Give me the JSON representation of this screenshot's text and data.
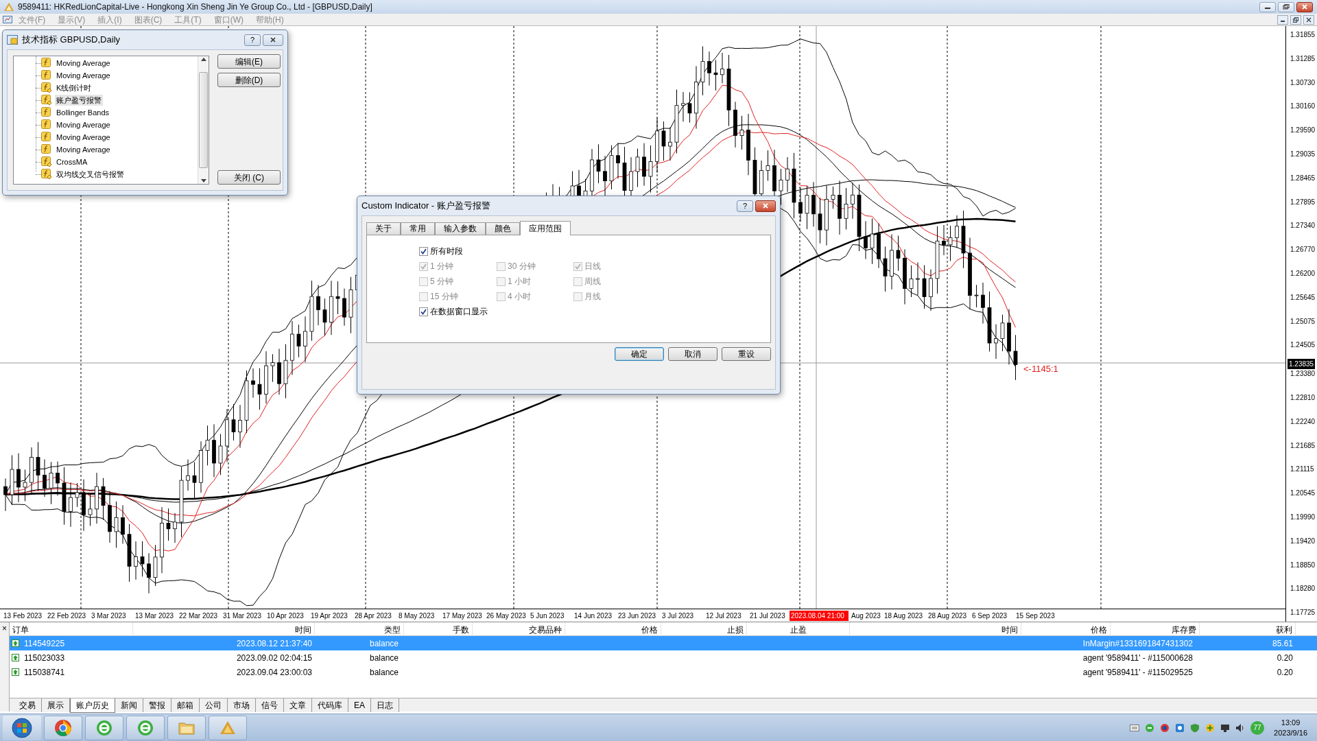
{
  "window": {
    "title": "9589411: HKRedLionCapital-Live - Hongkong Xin Sheng Jin Ye Group Co., Ltd - [GBPUSD,Daily]"
  },
  "menu": [
    "文件(F)",
    "显示(V)",
    "插入(I)",
    "图表(C)",
    "工具(T)",
    "窗口(W)",
    "帮助(H)"
  ],
  "chart": {
    "price_labels": [
      "1.31855",
      "1.31285",
      "1.30730",
      "1.30160",
      "1.29590",
      "1.29035",
      "1.28465",
      "1.27895",
      "1.27340",
      "1.26770",
      "1.26200",
      "1.25645",
      "1.25075",
      "1.24505",
      "1.23380",
      "1.22810",
      "1.22240",
      "1.21685",
      "1.21115",
      "1.20545",
      "1.19990",
      "1.19420",
      "1.18850",
      "1.18280",
      "1.17725"
    ],
    "current_price": "1.23835",
    "annotation": "<-1145:1",
    "date_labels": [
      {
        "text": "13 Feb 2023",
        "kind": "date"
      },
      {
        "text": "22 Feb 2023",
        "kind": "date"
      },
      {
        "text": "3 Mar 2023",
        "kind": "date"
      },
      {
        "text": "13 Mar 2023",
        "kind": "date"
      },
      {
        "text": "22 Mar 2023",
        "kind": "date"
      },
      {
        "text": "31 Mar 2023",
        "kind": "date"
      },
      {
        "text": "10 Apr 2023",
        "kind": "date"
      },
      {
        "text": "19 Apr 2023",
        "kind": "date"
      },
      {
        "text": "28 Apr 2023",
        "kind": "date"
      },
      {
        "text": "8 May 2023",
        "kind": "date"
      },
      {
        "text": "17 May 2023",
        "kind": "date"
      },
      {
        "text": "26 May 2023",
        "kind": "date"
      },
      {
        "text": "5 Jun 2023",
        "kind": "date"
      },
      {
        "text": "14 Jun 2023",
        "kind": "date"
      },
      {
        "text": "23 Jun 2023",
        "kind": "date"
      },
      {
        "text": "3 Jul 2023",
        "kind": "date"
      },
      {
        "text": "12 Jul 2023",
        "kind": "date"
      },
      {
        "text": "21 Jul 2023",
        "kind": "date"
      },
      {
        "text": "2023.08.04 21:00",
        "kind": "cursor"
      },
      {
        "text": "Aug 2023",
        "kind": "partial"
      },
      {
        "text": "18 Aug 2023",
        "kind": "date"
      },
      {
        "text": "28 Aug 2023",
        "kind": "date"
      },
      {
        "text": "6 Sep 2023",
        "kind": "date"
      },
      {
        "text": "15 Sep 2023",
        "kind": "date"
      }
    ]
  },
  "indicators_dialog": {
    "title": "技术指标 GBPUSD,Daily",
    "help": "?",
    "items": [
      {
        "name": "Moving Average",
        "kind": "builtin",
        "selected": false
      },
      {
        "name": "Moving Average",
        "kind": "builtin",
        "selected": false
      },
      {
        "name": "K线倒计时",
        "kind": "custom",
        "selected": false
      },
      {
        "name": "账户盈亏报警",
        "kind": "custom",
        "selected": true
      },
      {
        "name": "Bollinger Bands",
        "kind": "builtin",
        "selected": false
      },
      {
        "name": "Moving Average",
        "kind": "builtin",
        "selected": false
      },
      {
        "name": "Moving Average",
        "kind": "builtin",
        "selected": false
      },
      {
        "name": "Moving Average",
        "kind": "builtin",
        "selected": false
      },
      {
        "name": "CrossMA",
        "kind": "custom",
        "selected": false
      },
      {
        "name": "双均线交叉信号报警",
        "kind": "custom",
        "selected": false
      }
    ],
    "buttons": [
      "编辑(E)",
      "删除(D)",
      "关闭 (C)"
    ]
  },
  "custom_indicator_dialog": {
    "title": "Custom Indicator - 账户盈亏报警",
    "help": "?",
    "tabs": [
      {
        "label": "关于",
        "selected": false
      },
      {
        "label": "常用",
        "selected": false
      },
      {
        "label": "输入参数",
        "selected": false
      },
      {
        "label": "颜色",
        "selected": false
      },
      {
        "label": "应用范围",
        "selected": true
      }
    ],
    "all_periods": {
      "label": "所有时段",
      "checked": true,
      "disabled": false
    },
    "periods": [
      {
        "label": "1 分钟",
        "checked": true,
        "disabled": true
      },
      {
        "label": "30 分钟",
        "checked": false,
        "disabled": true
      },
      {
        "label": "日线",
        "checked": true,
        "disabled": true
      },
      {
        "label": "5 分钟",
        "checked": false,
        "disabled": true
      },
      {
        "label": "1 小时",
        "checked": false,
        "disabled": true
      },
      {
        "label": "周线",
        "checked": false,
        "disabled": true
      },
      {
        "label": "15 分钟",
        "checked": false,
        "disabled": true
      },
      {
        "label": "4 小时",
        "checked": false,
        "disabled": true
      },
      {
        "label": "月线",
        "checked": false,
        "disabled": true
      }
    ],
    "show_in_data_window": {
      "label": "在数据窗口显示",
      "checked": true,
      "disabled": false
    },
    "buttons": [
      {
        "label": "确定",
        "default": true
      },
      {
        "label": "取消",
        "default": false
      },
      {
        "label": "重设",
        "default": false
      }
    ]
  },
  "terminal": {
    "close": "×",
    "columns": [
      "订单",
      "时间",
      "类型",
      "手数",
      "交易品种",
      "价格",
      "止损",
      "止盈",
      "时间",
      "价格",
      "库存费",
      "获利"
    ],
    "rows": [
      {
        "order": "114549225",
        "time": "2023.08.12 21:37:40",
        "type": "balance",
        "comment": "InMargin#1331691847431302",
        "profit": "85.61",
        "selected": true
      },
      {
        "order": "115023033",
        "time": "2023.09.02 02:04:15",
        "type": "balance",
        "comment": "agent '9589411' - #115000628",
        "profit": "0.20",
        "selected": false
      },
      {
        "order": "115038741",
        "time": "2023.09.04 23:00:03",
        "type": "balance",
        "comment": "agent '9589411' - #115029525",
        "profit": "0.20",
        "selected": false
      }
    ],
    "tabs": [
      {
        "label": "交易",
        "selected": false
      },
      {
        "label": "展示",
        "selected": false
      },
      {
        "label": "账户历史",
        "selected": true
      },
      {
        "label": "新闻",
        "selected": false
      },
      {
        "label": "警报",
        "selected": false
      },
      {
        "label": "邮箱",
        "selected": false
      },
      {
        "label": "公司",
        "selected": false
      },
      {
        "label": "市场",
        "selected": false
      },
      {
        "label": "信号",
        "selected": false
      },
      {
        "label": "文章",
        "selected": false
      },
      {
        "label": "代码库",
        "selected": false
      },
      {
        "label": "EA",
        "selected": false
      },
      {
        "label": "日志",
        "selected": false
      }
    ]
  },
  "taskbar": {
    "tray_badge": "77",
    "time": "13:09",
    "date": "2023/9/16"
  }
}
